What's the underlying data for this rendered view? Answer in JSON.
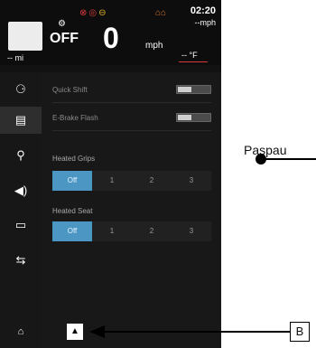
{
  "status_bar": {
    "time": "02:20",
    "speed_top": "--mph",
    "gear": "OFF",
    "speed": "0",
    "speed_unit": "mph",
    "odometer": "-- mi",
    "temperature": "-- °F",
    "warning_icons": [
      "engine-warning-icon",
      "abs-icon",
      "oil-icon"
    ],
    "right_icons": [
      "engine-icon",
      "battery-icon"
    ]
  },
  "sidebar": {
    "icons": [
      {
        "name": "motorcycle-icon",
        "glyph": "🏍"
      },
      {
        "name": "settings-card-icon",
        "glyph": "▤"
      },
      {
        "name": "link-icon",
        "glyph": "⚲"
      },
      {
        "name": "speaker-icon",
        "glyph": "🔊"
      },
      {
        "name": "display-icon",
        "glyph": "▭"
      },
      {
        "name": "sliders-icon",
        "glyph": "⇆"
      }
    ],
    "active_index": 1
  },
  "settings": {
    "quick_shift": {
      "label": "Quick Shift",
      "enabled": false
    },
    "ebrake_flash": {
      "label": "E-Brake Flash",
      "enabled": false
    },
    "heated_grips": {
      "label": "Heated Grips",
      "options": [
        "Off",
        "1",
        "2",
        "3"
      ],
      "selected": "Off"
    },
    "heated_seat": {
      "label": "Heated Seat",
      "options": [
        "Off",
        "1",
        "2",
        "3"
      ],
      "selected": "Off"
    }
  },
  "bottom": {
    "home_icon": "home-icon",
    "up_icon": "up-arrow-icon",
    "up_glyph": "▲"
  },
  "annotations": {
    "paspaudus_label": "Paspau",
    "b_label": "B"
  },
  "colors": {
    "accent": "#4c96c4",
    "warning_red": "#d83a3a",
    "warning_yellow": "#e0b422"
  }
}
